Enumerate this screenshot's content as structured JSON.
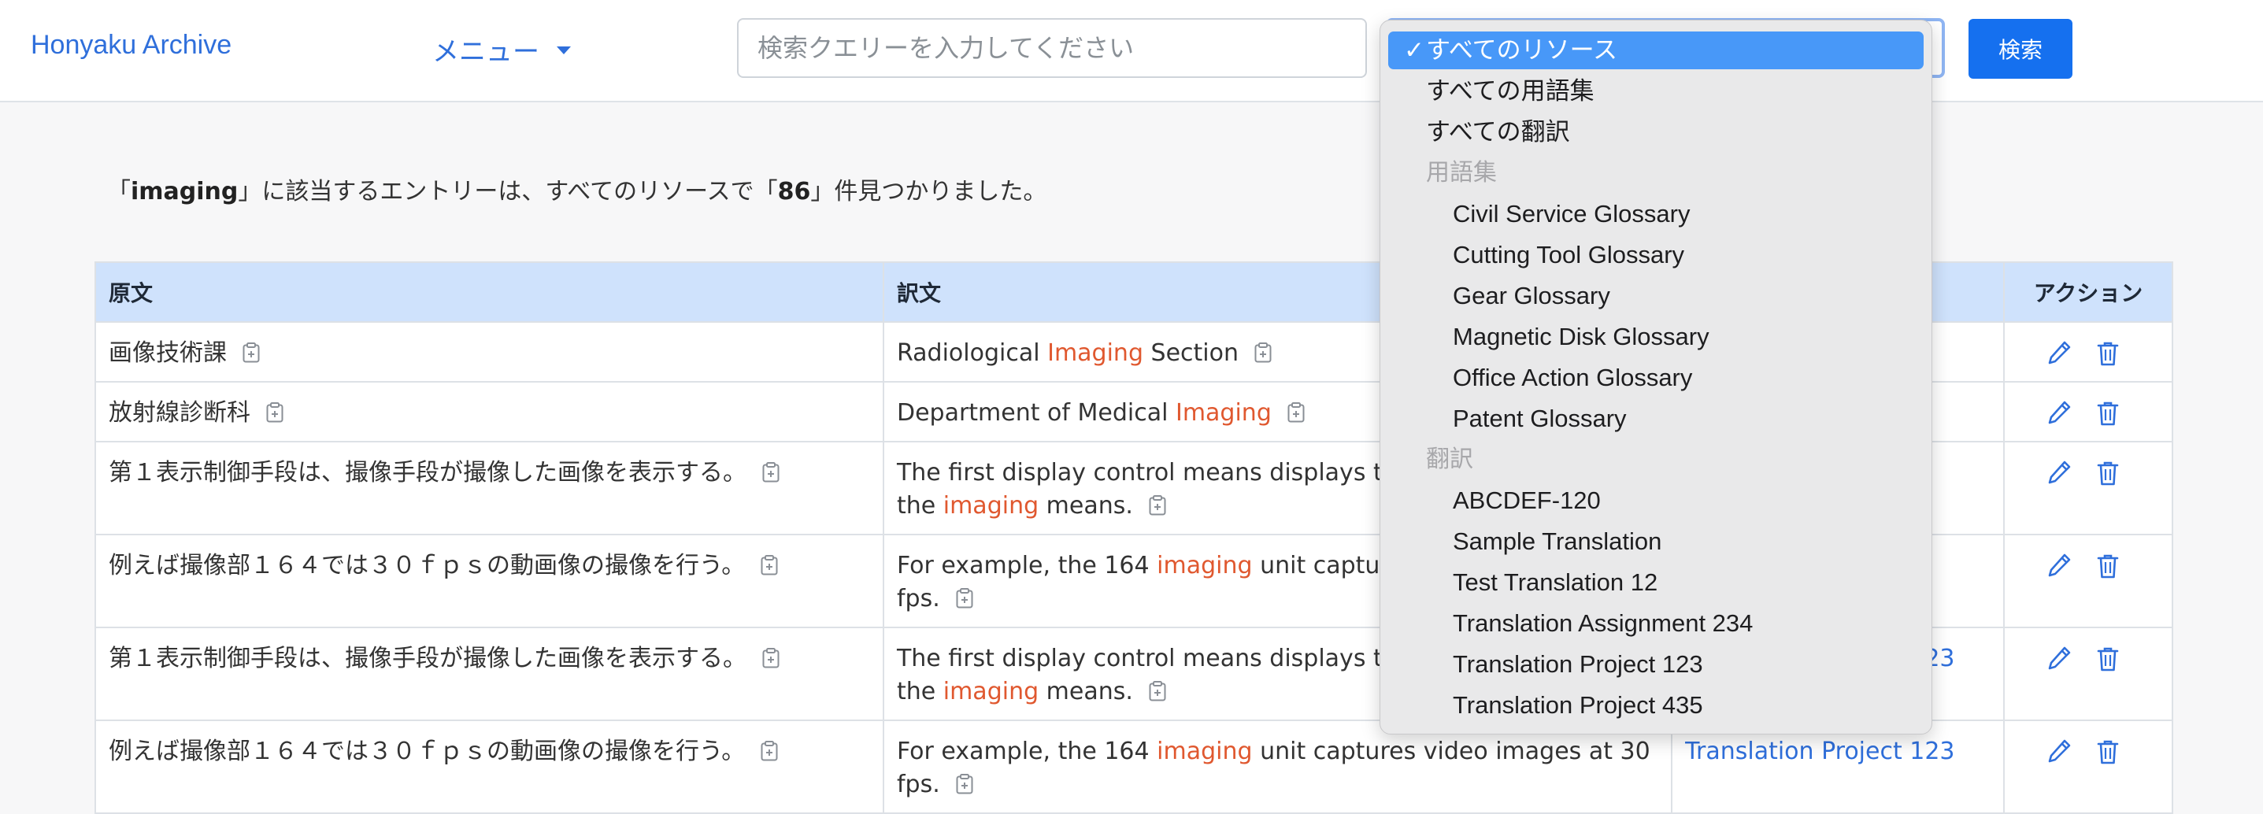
{
  "navbar": {
    "brand": "Honyaku Archive",
    "menu_label": "メニュー",
    "search_placeholder": "検索クエリーを入力してください",
    "search_value": "",
    "search_button": "検索"
  },
  "summary": {
    "prefix": "「",
    "query": "imaging",
    "middle": "」に該当するエントリーは、すべてのリソースで「",
    "count": "86",
    "suffix": "」件見つかりました。"
  },
  "table": {
    "headers": {
      "source": "原文",
      "target": "訳文",
      "resource": "",
      "actions": "アクション"
    },
    "rows": [
      {
        "source": "画像技術課",
        "target_pre": "Radiological ",
        "target_hl": "Imaging",
        "target_post": " Section",
        "resource": ""
      },
      {
        "source": "放射線診断科",
        "target_pre": "Department of Medical ",
        "target_hl": "Imaging",
        "target_post": "",
        "resource": ""
      },
      {
        "source": "第１表示制御手段は、撮像手段が撮像した画像を表示する。",
        "target_pre": "The first display control means displays the image captured by the ",
        "target_hl": "imaging",
        "target_post": " means.",
        "resource": ""
      },
      {
        "source": "例えば撮像部１６４では３０ｆｐｓの動画像の撮像を行う。",
        "target_pre": "For example, the 164 ",
        "target_hl": "imaging",
        "target_post": " unit captures video images at 30 fps.",
        "resource": ""
      },
      {
        "source": "第１表示制御手段は、撮像手段が撮像した画像を表示する。",
        "target_pre": "The first display control means displays the image captured by the ",
        "target_hl": "imaging",
        "target_post": " means.",
        "resource": "Translation Project 123"
      },
      {
        "source": "例えば撮像部１６４では３０ｆｐｓの動画像の撮像を行う。",
        "target_pre": "For example, the 164 ",
        "target_hl": "imaging",
        "target_post": " unit captures video images at 30 fps.",
        "resource": "Translation Project 123"
      }
    ]
  },
  "dropdown": {
    "selected": "すべてのリソース",
    "check_mark": "✓",
    "top_items": [
      "すべてのリソース",
      "すべての用語集",
      "すべての翻訳"
    ],
    "groups": [
      {
        "label": "用語集",
        "items": [
          "Civil Service Glossary",
          "Cutting Tool Glossary",
          "Gear Glossary",
          "Magnetic Disk Glossary",
          "Office Action Glossary",
          "Patent Glossary"
        ]
      },
      {
        "label": "翻訳",
        "items": [
          "ABCDEF-120",
          "Sample Translation",
          "Test Translation 12",
          "Translation Assignment 234",
          "Translation Project 123",
          "Translation Project 435"
        ]
      }
    ]
  },
  "colors": {
    "link": "#2f6fdb",
    "highlight": "#e0582f",
    "primary_button": "#1570ef",
    "table_header": "#cfe2fc",
    "dropdown_selected": "#4898f8"
  }
}
